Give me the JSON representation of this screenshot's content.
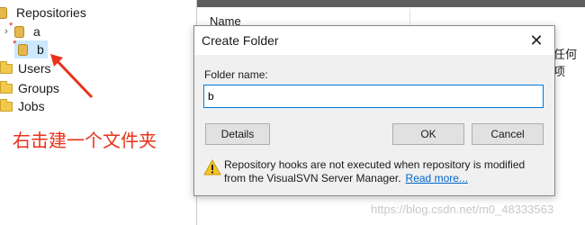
{
  "tree": {
    "root_label": "Repositories",
    "repos": [
      "a",
      "b"
    ],
    "folders": [
      "Users",
      "Groups",
      "Jobs"
    ]
  },
  "right_pane": {
    "column_header": "Name",
    "clipped_text": "任何项"
  },
  "annotation": {
    "text": "右击建一个文件夹",
    "color": "#e8321a"
  },
  "dialog": {
    "title": "Create Folder",
    "close_glyph": "✕",
    "folder_name_label": "Folder name:",
    "folder_name_value": "b",
    "details_label": "Details",
    "ok_label": "OK",
    "cancel_label": "Cancel",
    "warning_text": "Repository hooks are not executed when repository is modified from the VisualSVN Server Manager.",
    "read_more_label": "Read more..."
  },
  "watermark": "https://blog.csdn.net/m0_48333563",
  "colors": {
    "accent": "#0078d7",
    "link": "#0066cc",
    "selection": "#cce8ff"
  }
}
